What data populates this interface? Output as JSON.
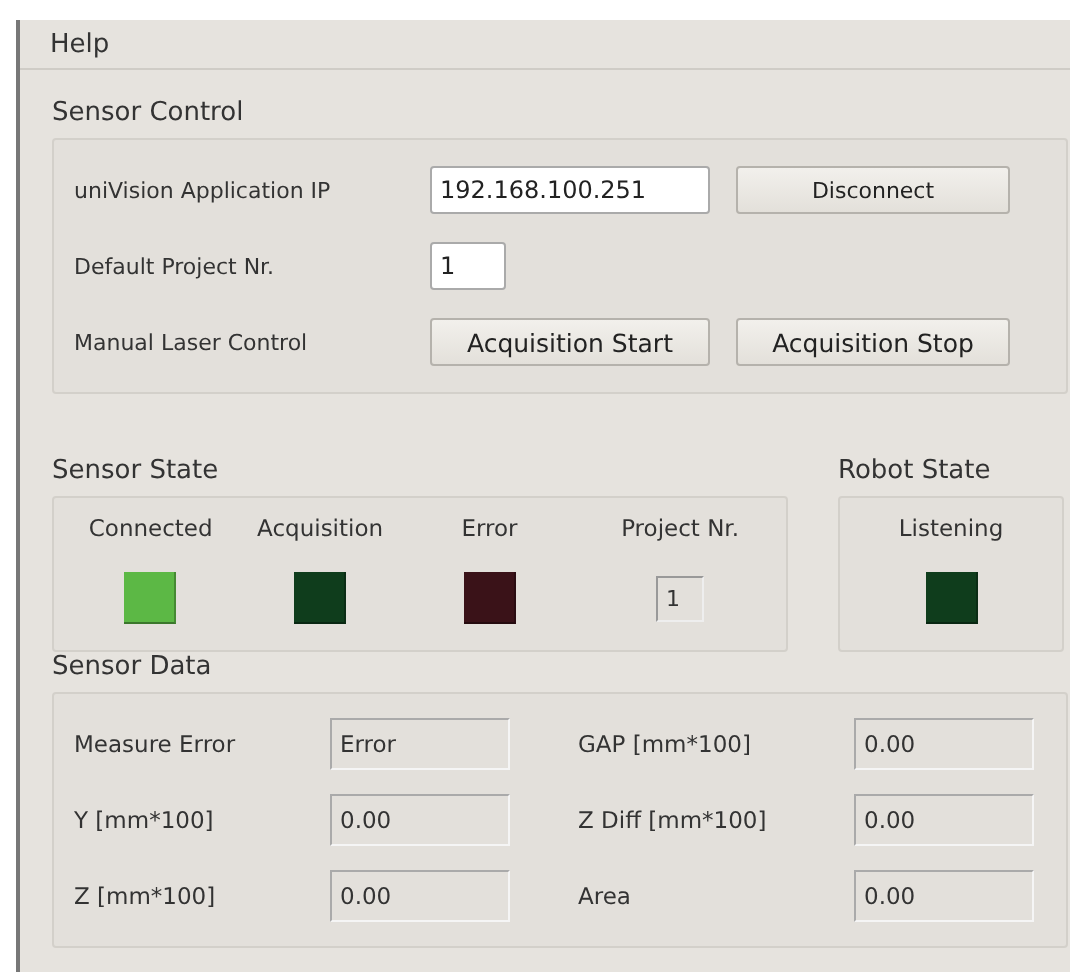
{
  "menu": [
    {
      "label": "Help"
    }
  ],
  "sensor_control": {
    "title": "Sensor Control",
    "ip": {
      "label": "uniVision Application IP",
      "value": "192.168.100.251"
    },
    "connect_button": "Disconnect",
    "project": {
      "label": "Default Project Nr.",
      "value": "1"
    },
    "laser": {
      "label": "Manual Laser Control",
      "buttons": [
        "Acquisition Start",
        "Acquisition Stop"
      ]
    }
  },
  "sensor_state": {
    "title": "Sensor State",
    "indicators": [
      {
        "label": "Connected",
        "color": "#5cb845"
      },
      {
        "label": "Acquisition",
        "color": "#0f3d1c"
      },
      {
        "label": "Error",
        "color": "#3a1218"
      }
    ],
    "project": {
      "label": "Project Nr.",
      "value": "1"
    }
  },
  "robot_state": {
    "title": "Robot State",
    "indicators": [
      {
        "label": "Listening",
        "color": "#0f3d1c"
      }
    ]
  },
  "sensor_data": {
    "title": "Sensor Data",
    "fields": [
      {
        "label": "Measure Error",
        "value": "Error"
      },
      {
        "label": "GAP [mm*100]",
        "value": "0.00"
      },
      {
        "label": "Y [mm*100]",
        "value": "0.00"
      },
      {
        "label": "Z Diff [mm*100]",
        "value": "0.00"
      },
      {
        "label": "Z [mm*100]",
        "value": "0.00"
      },
      {
        "label": "Area",
        "value": "0.00"
      }
    ]
  }
}
